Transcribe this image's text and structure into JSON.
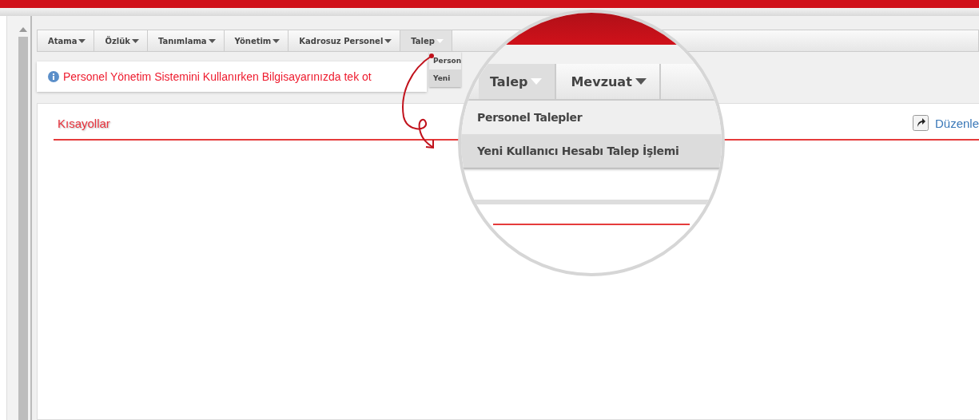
{
  "menu": {
    "items": [
      {
        "label": "Atama",
        "selected": false
      },
      {
        "label": "Özlük",
        "selected": false
      },
      {
        "label": "Tanımlama",
        "selected": false
      },
      {
        "label": "Yönetim",
        "selected": false
      },
      {
        "label": "Kadrosuz Personel",
        "selected": false
      },
      {
        "label": "Talep",
        "selected": true
      }
    ]
  },
  "dropdown": {
    "items": [
      {
        "label": "Person",
        "highlighted": false
      },
      {
        "label": "Yeni",
        "highlighted": true
      }
    ]
  },
  "notice": {
    "text": "Personel Yönetim Sistemini Kullanırken Bilgisayarınızda tek ot"
  },
  "panel": {
    "title": "Kısayollar",
    "action": "Düzenle"
  },
  "magnifier": {
    "menu": [
      {
        "label": "Talep",
        "selected": true
      },
      {
        "label": "Mevzuat",
        "selected": false
      }
    ],
    "dropdown": [
      {
        "label": "Personel Talepler",
        "highlighted": false
      },
      {
        "label": "Yeni Kullanıcı Hesabı Talep İşlemi",
        "highlighted": true
      }
    ]
  }
}
